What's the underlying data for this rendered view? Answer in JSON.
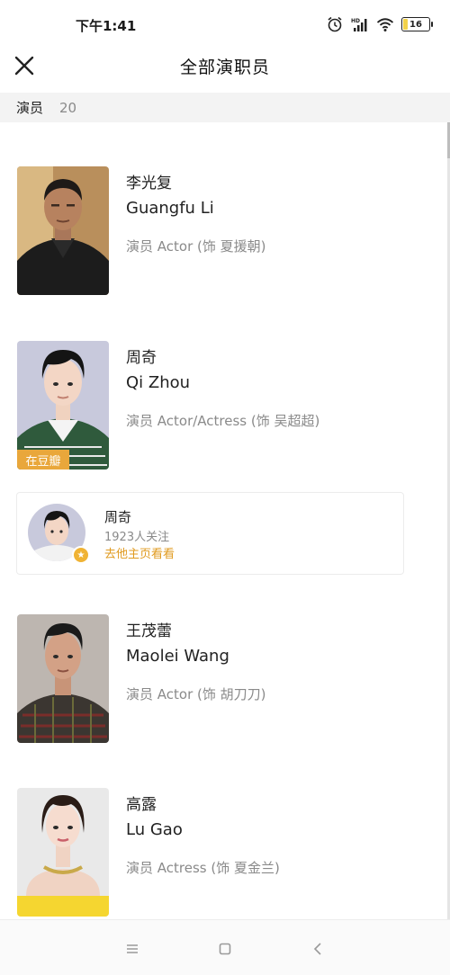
{
  "status_bar": {
    "time": "下午1:41",
    "battery_level": "16",
    "icons": [
      "alarm-icon",
      "hd-signal-icon",
      "wifi-icon",
      "battery-icon"
    ]
  },
  "header": {
    "title": "全部演职员",
    "close_icon": "close-icon"
  },
  "section": {
    "label": "演员",
    "count": "20"
  },
  "cast": [
    {
      "name_zh": "李光复",
      "name_en": "Guangfu Li",
      "role": "演员 Actor (饰 夏援朝)"
    },
    {
      "name_zh": "周奇",
      "name_en": "Qi Zhou",
      "role": "演员 Actor/Actress (饰 吴超超)",
      "badge": "在豆瓣"
    },
    {
      "name_zh": "王茂蕾",
      "name_en": "Maolei Wang",
      "role": "演员 Actor (饰 胡刀刀)"
    },
    {
      "name_zh": "高露",
      "name_en": "Lu Gao",
      "role": "演员 Actress (饰 夏金兰)"
    }
  ],
  "profile_card": {
    "name": "周奇",
    "followers": "1923人关注",
    "link": "去他主页看看"
  },
  "nav_bar": {
    "icons": [
      "menu-icon",
      "home-icon",
      "back-icon"
    ]
  },
  "colors": {
    "accent": "#e09a1e",
    "badge": "#e9a73b",
    "section_bg": "#f3f3f3",
    "secondary_text": "#8a8a8a"
  }
}
